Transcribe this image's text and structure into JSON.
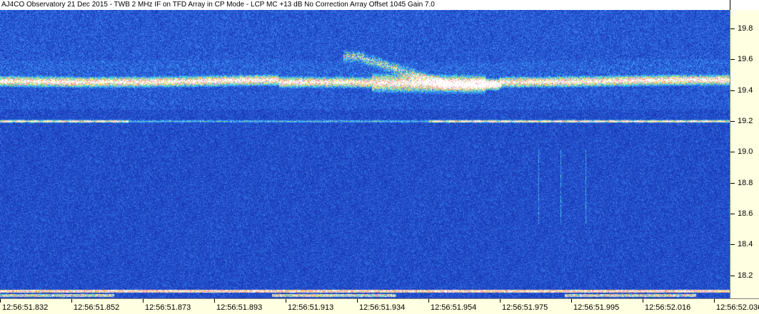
{
  "window": {
    "title": "AJ4CO Observatory 21 Dec 2015 - TWB 2 MHz IF on TFD Array in CP Mode - LCP  MC +13 dB  No Correction Array  Offset 1045  Gain 7.0"
  },
  "colors": {
    "background_low": "#1b3ba8",
    "noise_mid": "#3a6fe0",
    "hot_cyan": "#40e8ff",
    "hot_yellow": "#f4f040",
    "hot_magenta": "#ff50c0",
    "axis_bg": "#ffffe1"
  },
  "chart_data": {
    "type": "heatmap",
    "title": "AJ4CO Observatory 21 Dec 2015 - TWB 2 MHz IF on TFD Array in CP Mode - LCP  MC +13 dB  No Correction Array  Offset 1045  Gain 7.0",
    "xlabel": "",
    "ylabel": "",
    "x_tick_labels": [
      "12:56:51.832",
      "12:56:51.852",
      "12:56:51.873",
      "12:56:51.893",
      "12:56:51.913",
      "12:56:51.934",
      "12:56:51.954",
      "12:56:51.975",
      "12:56:51.995",
      "12:56:52.016",
      "12:56:52.036"
    ],
    "y_tick_labels": [
      "19.8",
      "19.6",
      "19.4",
      "19.2",
      "19.0",
      "18.8",
      "18.6",
      "18.4",
      "18.2"
    ],
    "y_ticks": [
      19.8,
      19.6,
      19.4,
      19.2,
      19.0,
      18.8,
      18.6,
      18.4,
      18.2
    ],
    "ylim": [
      18.05,
      19.92
    ],
    "x_time_range_s": [
      51.832,
      52.036
    ],
    "colormap": "spectrogram blue-cyan-yellow-magenta",
    "features": [
      {
        "name": "emission band",
        "freq_center": 19.46,
        "intensity": 0.85,
        "time_range": [
          51.832,
          52.036
        ]
      },
      {
        "name": "drifting burst",
        "freq_start": 19.62,
        "freq_end": 19.44,
        "time_range": [
          51.932,
          51.956
        ]
      },
      {
        "name": "pulsed carrier",
        "freq_center": 19.2,
        "intensity": 0.95,
        "time_range": [
          51.832,
          52.036
        ]
      },
      {
        "name": "carrier",
        "freq_center": 18.1,
        "intensity": 0.75,
        "time_range": [
          51.832,
          52.036
        ]
      }
    ]
  }
}
